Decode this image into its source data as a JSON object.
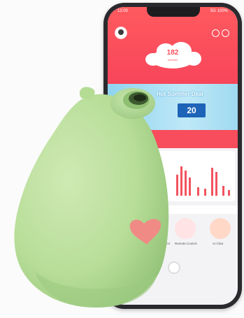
{
  "phone": {
    "status_time": "12:00",
    "status_right": "5G 100%",
    "cloud_value": "182",
    "cloud_caption": "minutes",
    "banner_title": "Hot Summer Deal",
    "banner_price": "20",
    "feature_labels": [
      "Voice Control",
      "Remote Control",
      "AI Chat"
    ]
  },
  "colors": {
    "app_red": "#f7435a",
    "toy_green": "#b7dd98",
    "heart": "#f08a85",
    "banner_blue": "#8fd4f0"
  }
}
